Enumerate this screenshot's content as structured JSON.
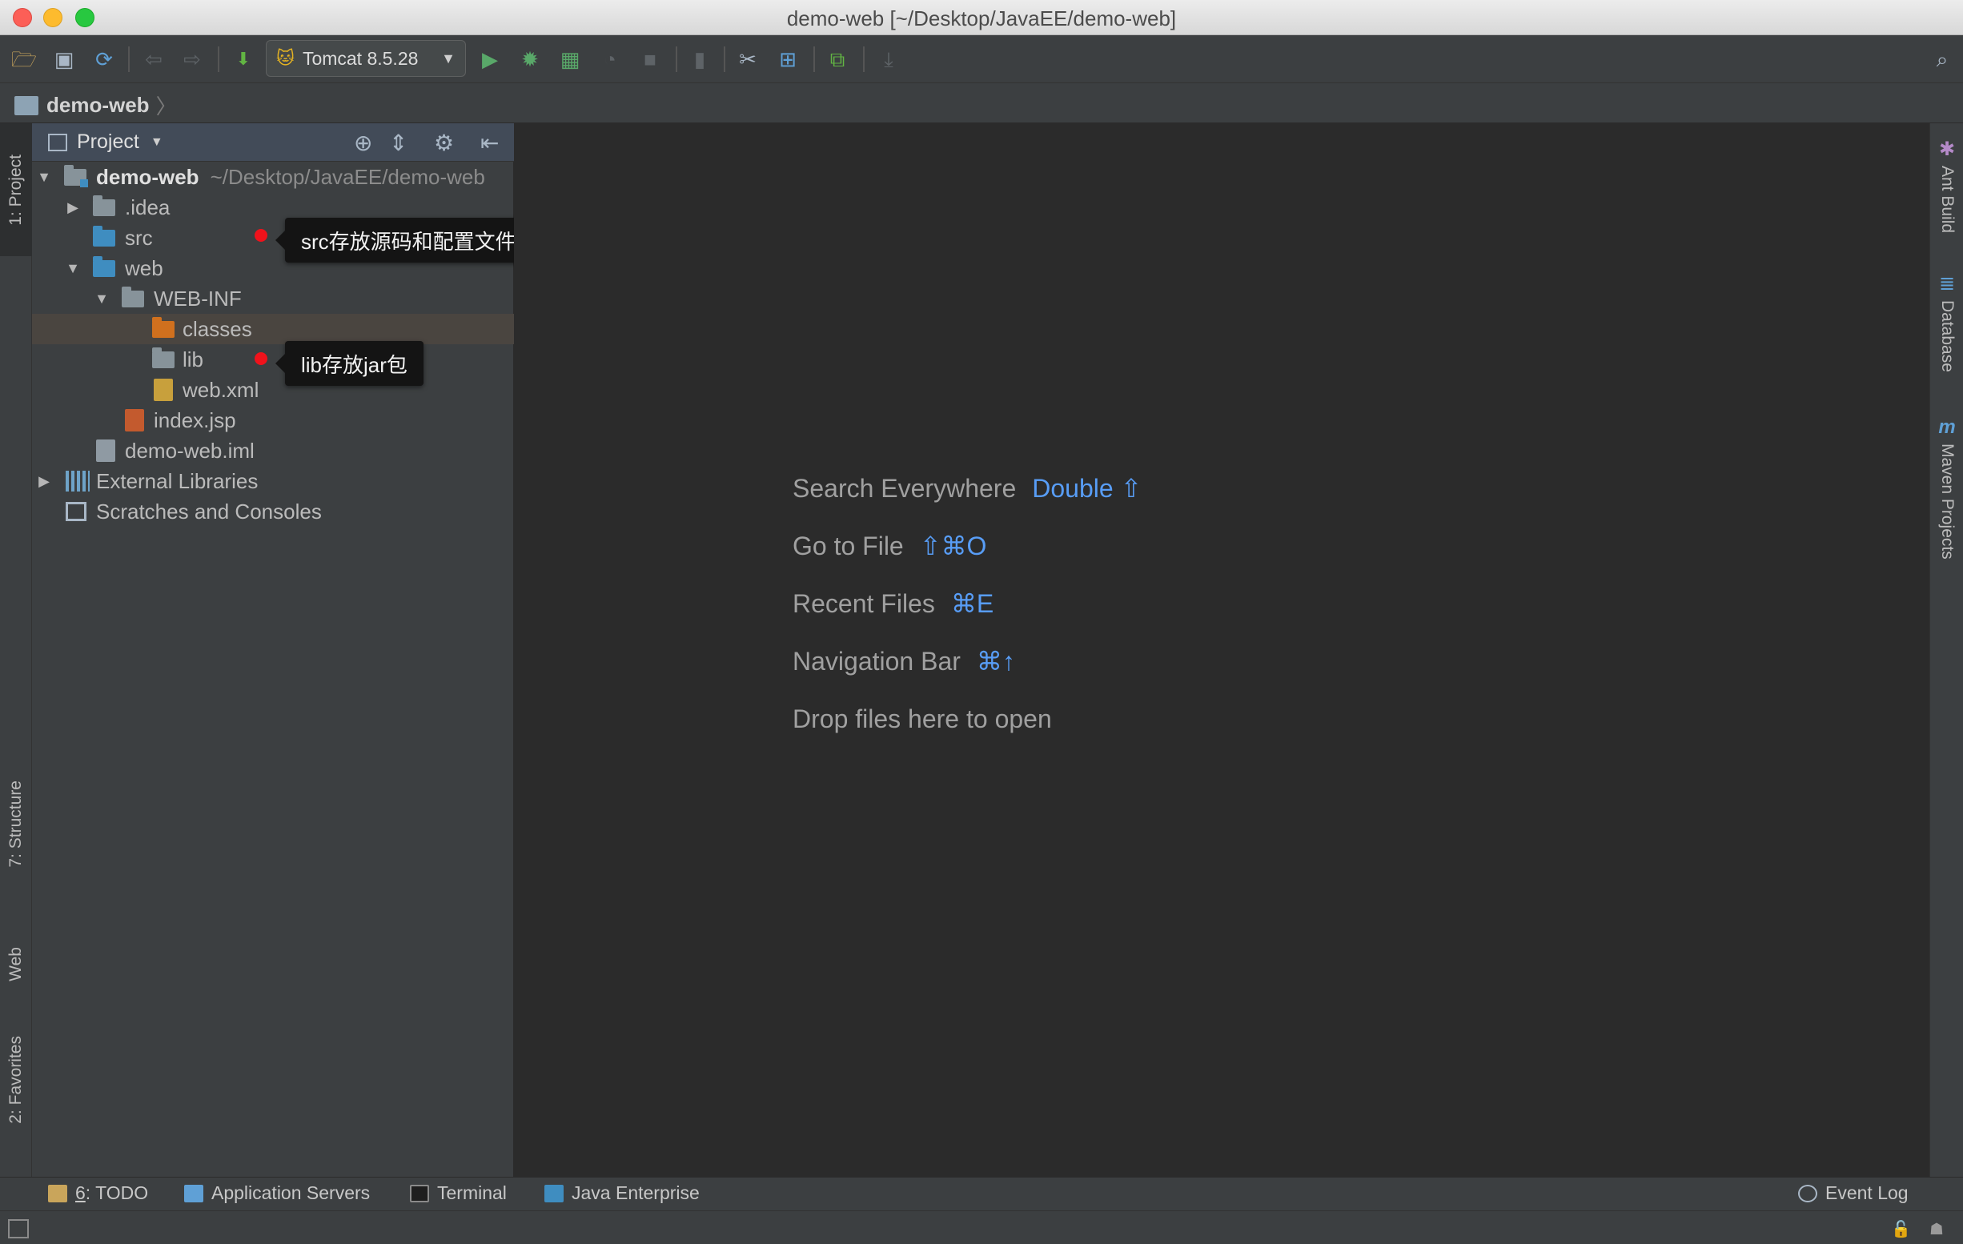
{
  "window": {
    "title": "demo-web [~/Desktop/JavaEE/demo-web]"
  },
  "toolbar": {
    "icons": [
      "open-folder-icon",
      "save-icon",
      "sync-icon",
      "back-icon",
      "forward-icon",
      "build-icon"
    ],
    "run_config": "Tomcat 8.5.28",
    "run_icons": [
      "run-icon",
      "debug-icon",
      "coverage-icon",
      "profile-icon",
      "stop-icon"
    ],
    "misc_icons": [
      "bookmark-icon",
      "settings-icon",
      "project-structure-icon",
      "deploy-icon",
      "download-icon",
      "search-icon"
    ]
  },
  "breadcrumb": {
    "project": "demo-web"
  },
  "left_tabs": [
    {
      "label": "1: Project"
    },
    {
      "label": "7: Structure"
    },
    {
      "label": "Web"
    },
    {
      "label": "2: Favorites"
    }
  ],
  "project_panel": {
    "title": "Project",
    "tree": {
      "root_name": "demo-web",
      "root_path": "~/Desktop/JavaEE/demo-web",
      "idea": ".idea",
      "src": "src",
      "web": "web",
      "webinf": "WEB-INF",
      "classes": "classes",
      "lib": "lib",
      "webxml": "web.xml",
      "indexjsp": "index.jsp",
      "iml": "demo-web.iml",
      "extlib": "External Libraries",
      "scratches": "Scratches and Consoles"
    }
  },
  "annotations": {
    "src_note": "src存放源码和配置文件",
    "lib_note": "lib存放jar包",
    "dot_color": "#f0121b"
  },
  "editor": {
    "hints": [
      {
        "label": "Search Everywhere",
        "shortcut": "Double ⇧"
      },
      {
        "label": "Go to File",
        "shortcut": "⇧⌘O"
      },
      {
        "label": "Recent Files",
        "shortcut": "⌘E"
      },
      {
        "label": "Navigation Bar",
        "shortcut": "⌘↑"
      },
      {
        "label": "Drop files here to open",
        "shortcut": ""
      }
    ],
    "shortcut_color": "#589df6"
  },
  "right_tabs": [
    {
      "label": "Ant Build"
    },
    {
      "label": "Database"
    },
    {
      "label": "Maven Projects"
    }
  ],
  "bottom_tabs": {
    "todo_num": "6",
    "todo_label": ": TODO",
    "app_servers": "Application Servers",
    "terminal": "Terminal",
    "java_enterprise": "Java Enterprise",
    "event_log": "Event Log"
  }
}
